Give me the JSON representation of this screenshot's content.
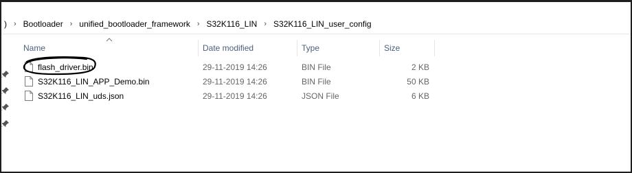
{
  "breadcrumb": {
    "edge": ")",
    "items": [
      "Bootloader",
      "unified_bootloader_framework",
      "S32K116_LIN",
      "S32K116_LIN_user_config"
    ],
    "separator": "›"
  },
  "columns": {
    "name": "Name",
    "date_modified": "Date modified",
    "type": "Type",
    "size": "Size"
  },
  "files": [
    {
      "name": "flash_driver.bin",
      "date": "29-11-2019 14:26",
      "type": "BIN File",
      "size": "2 KB",
      "circled": true
    },
    {
      "name": "S32K116_LIN_APP_Demo.bin",
      "date": "29-11-2019 14:26",
      "type": "BIN File",
      "size": "50 KB"
    },
    {
      "name": "S32K116_LIN_uds.json",
      "date": "29-11-2019 14:26",
      "type": "JSON File",
      "size": "6 KB"
    }
  ],
  "icons": {
    "file": "file-icon",
    "pin": "pin-icon",
    "sort": "sort-up-icon"
  },
  "colors": {
    "header_text": "#4c607a",
    "meta_text": "#666666",
    "annotation": "#000000"
  }
}
